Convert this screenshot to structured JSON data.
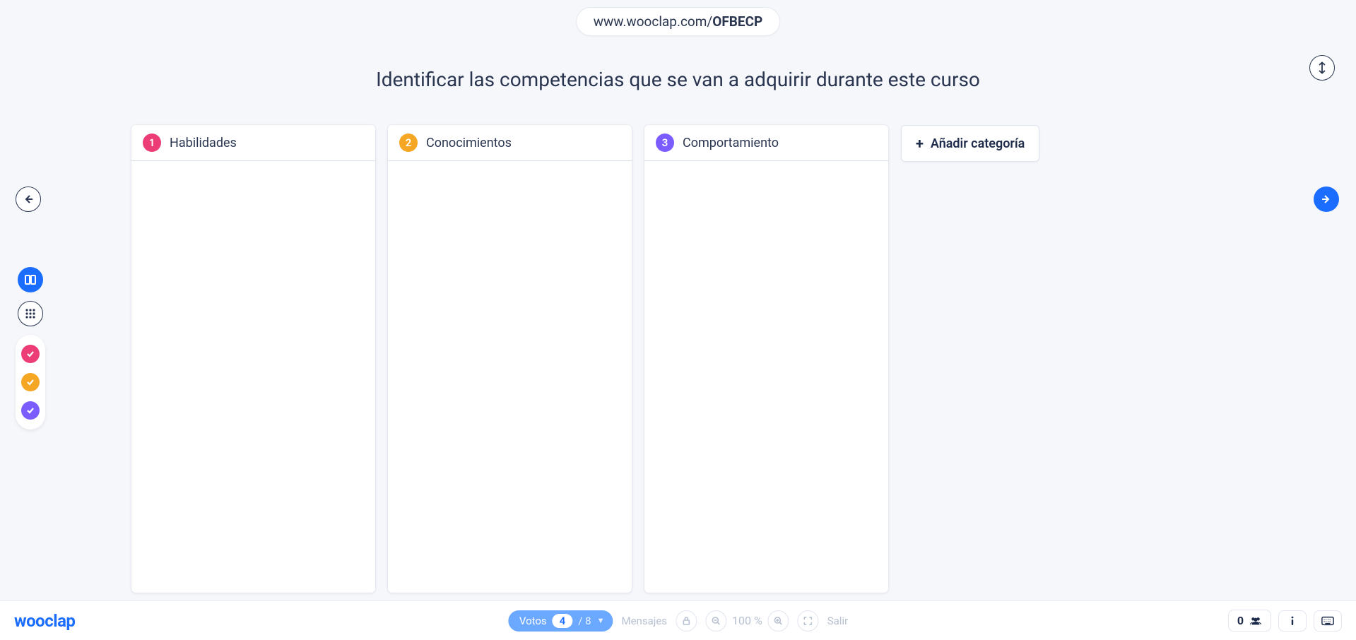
{
  "url": {
    "base": "www.wooclap.com/",
    "code": "OFBECP"
  },
  "question": "Identificar las competencias que se van a adquirir durante este curso",
  "columns": [
    {
      "num": "1",
      "title": "Habilidades",
      "color": "#ec3d77"
    },
    {
      "num": "2",
      "title": "Conocimientos",
      "color": "#f5a623"
    },
    {
      "num": "3",
      "title": "Comportamiento",
      "color": "#7b5cff"
    }
  ],
  "add_category_label": "Añadir categoría",
  "color_filters": [
    {
      "color": "#ec3d77"
    },
    {
      "color": "#f5a623"
    },
    {
      "color": "#7b5cff"
    }
  ],
  "bottom": {
    "logo": "wooclap",
    "votes_label": "Votos",
    "votes_count": "4",
    "votes_total": "/ 8",
    "messages_label": "Mensajes",
    "zoom_value": "100 %",
    "exit_label": "Salir",
    "participants_count": "0"
  }
}
